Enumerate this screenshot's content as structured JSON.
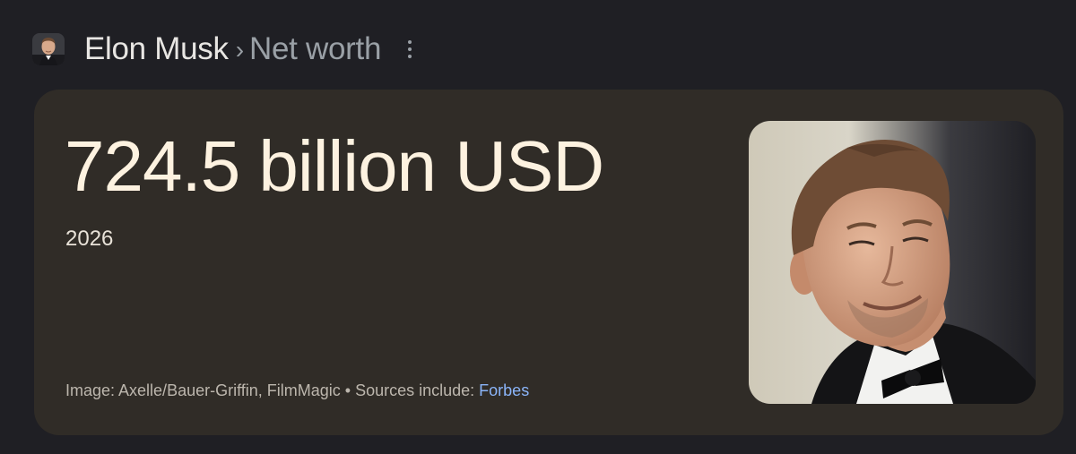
{
  "breadcrumb": {
    "entity": "Elon Musk",
    "separator": "›",
    "attribute": "Net worth"
  },
  "icons": {
    "avatar": "person-avatar-icon",
    "more": "more-vert-icon",
    "photo": "portrait-photo"
  },
  "card": {
    "value": "724.5 billion USD",
    "year": "2026",
    "image_credit": "Image: Axelle/Bauer-Griffin, FilmMagic",
    "bullet": " • ",
    "sources_label": "Sources include: ",
    "source_link": "Forbes"
  },
  "colors": {
    "background": "#1f1f24",
    "card": "#302c27",
    "value_text": "#fdf2e0",
    "link": "#8ab4f8",
    "muted": "#9aa0a6"
  }
}
